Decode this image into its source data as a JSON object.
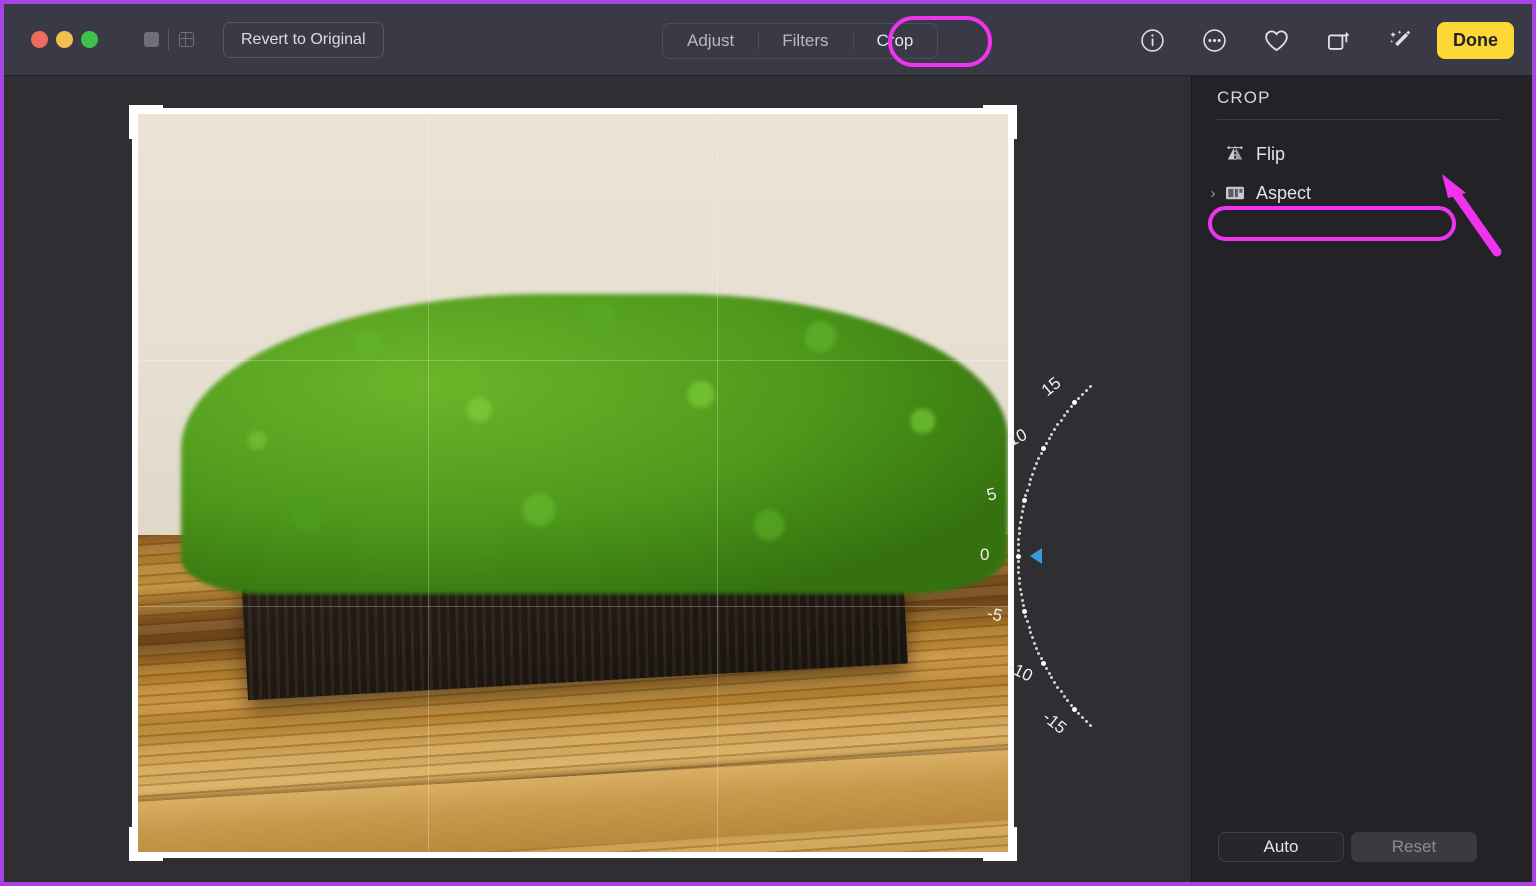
{
  "window": {
    "traffic_lights": [
      "close",
      "minimize",
      "zoom"
    ],
    "view_modes": [
      {
        "name": "single-view",
        "icon": "filled-square-icon"
      },
      {
        "name": "grid-view",
        "icon": "grid-square-icon"
      }
    ],
    "revert_label": "Revert to Original"
  },
  "tabs": [
    {
      "label": "Adjust",
      "active": false
    },
    {
      "label": "Filters",
      "active": false
    },
    {
      "label": "Crop",
      "active": true
    }
  ],
  "toolbar_right": {
    "icons": [
      {
        "name": "info-icon",
        "glyph": "i"
      },
      {
        "name": "more-options-icon",
        "glyph": "..."
      },
      {
        "name": "favorite-heart-icon",
        "glyph": "heart"
      },
      {
        "name": "rotate-icon",
        "glyph": "rotate"
      },
      {
        "name": "auto-enhance-wand-icon",
        "glyph": "wand"
      }
    ],
    "done_label": "Done"
  },
  "sidebar": {
    "title": "CROP",
    "rows": [
      {
        "label": "Flip",
        "icon": "flip-icon",
        "has_chevron": false,
        "highlighted": true
      },
      {
        "label": "Aspect",
        "icon": "aspect-icon",
        "has_chevron": true,
        "highlighted": false
      }
    ],
    "auto_label": "Auto",
    "reset_label": "Reset"
  },
  "straighten_dial": {
    "name": "rotation-angle-dial",
    "unit": "degrees",
    "current_value": "0",
    "labels": [
      "15",
      "10",
      "5",
      "0",
      "-5",
      "-10",
      "-15"
    ]
  },
  "photo": {
    "subject": "green moss arrangement in dark planter on wooden table",
    "crop_frame": "active"
  },
  "annotations": {
    "accent_color": "#ef33ef",
    "border_color": "#a743e0",
    "callouts": [
      {
        "name": "crop-tab-highlight",
        "target": "Crop"
      },
      {
        "name": "flip-row-highlight",
        "target": "Flip"
      },
      {
        "name": "flip-arrow-pointer",
        "target": "Flip"
      }
    ]
  },
  "colors": {
    "toolbar_bg": "#3a3a46",
    "canvas_bg": "#2e2e33",
    "sidebar_bg": "#222227",
    "done_yellow": "#fcd736",
    "dial_pointer_blue": "#3a9bdc"
  }
}
